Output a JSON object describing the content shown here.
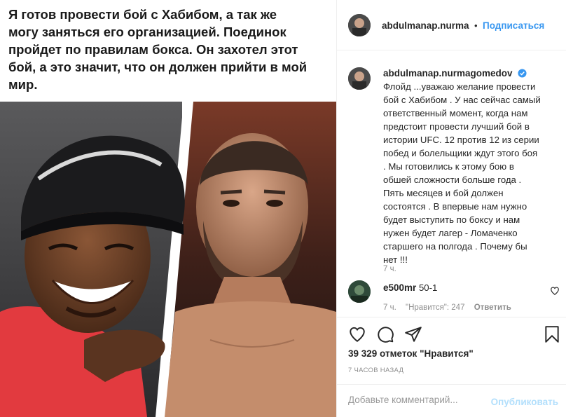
{
  "post": {
    "quote_text": "Я готов провести бой с Хабибом, а так же\nмогу заняться его организацией. Поединок\nпройдет по правилам бокса. Он захотел этот\nбой, а это значит, что он должен прийти в мой\nмир."
  },
  "header": {
    "username": "abdulmanap.nurma",
    "separator": "•",
    "follow_label": "Подписаться"
  },
  "caption": {
    "username": "abdulmanap.nurmagomedov",
    "text": "Флойд ...уважаю желание провести\nбой с Хабибом . У нас сейчас самый\nответственный момент, когда нам\nпредстоит провести лучший бой в\nистории UFC. 12 против 12 из серии\nпобед и болельщики ждут этого боя\n. Мы готовились к этому бою в\nобшей сложности больше года .\nПять месяцев и бой должен\nсостоятся . В впервые нам нужно\nбудет выступить по боксу и нам\nнужен будет лагер - Ломаченко\nстаршего на полгода . Почему бы\nнет !!!",
    "time": "7 ч."
  },
  "comment": {
    "username": "e500mr",
    "text": "50-1",
    "time": "7 ч.",
    "likes": "\"Нравится\": 247",
    "reply_label": "Ответить"
  },
  "stats": {
    "likes": "39 329 отметок \"Нравится\"",
    "posted_ago": "7 ЧАСОВ НАЗАД"
  },
  "add_comment": {
    "placeholder": "Добавьте комментарий...",
    "publish_label": "Опубликовать"
  },
  "colors": {
    "accent": "#3897f0",
    "verified": "#3897f0",
    "muted": "#8e8e8e",
    "publish_disabled": "#b2dffc"
  },
  "icons": [
    "heart-icon",
    "comment-icon",
    "share-icon",
    "bookmark-icon",
    "verified-badge-icon",
    "small-heart-icon"
  ]
}
